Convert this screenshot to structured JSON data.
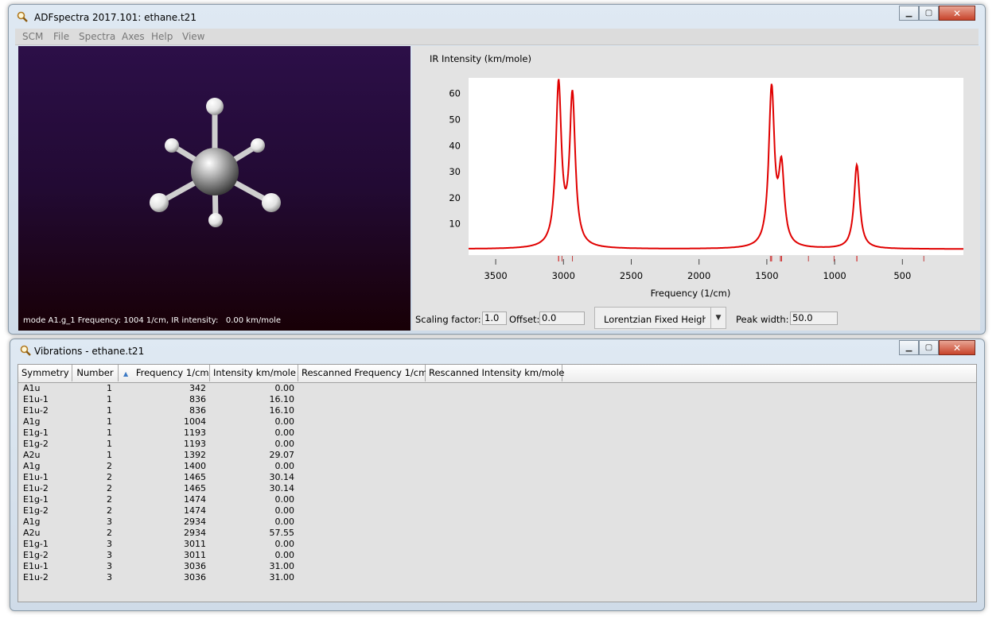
{
  "main_window": {
    "title": "ADFspectra 2017.101: ethane.t21",
    "menu": [
      "SCM",
      "File",
      "Spectra",
      "Axes",
      "Help",
      "View"
    ],
    "mode_text": "mode A1.g_1 Frequency: 1004 1/cm, IR intensity:   0.00 km/mole",
    "scaling_label": "Scaling factor:",
    "scaling_value": "1.0",
    "offset_label": "Offset:",
    "offset_value": "0.0",
    "lineshape_value": "Lorentzian Fixed Height",
    "peak_width_label": "Peak width:",
    "peak_width_value": "50.0"
  },
  "chart_data": {
    "type": "line",
    "title": "",
    "ylabel": "IR Intensity (km/mole)",
    "xlabel": "Frequency (1/cm)",
    "x_reversed": true,
    "xlim": [
      3700,
      50
    ],
    "ylim": [
      -2,
      66
    ],
    "xticks": [
      3500,
      3000,
      2500,
      2000,
      1500,
      1000,
      500
    ],
    "yticks": [
      10,
      20,
      30,
      40,
      50,
      60
    ],
    "line_color": "#e00000",
    "peak_width": 50,
    "lineshape": "lorentzian",
    "baseline": 0.3,
    "modes": [
      {
        "freq": 342,
        "intensity": 0.0
      },
      {
        "freq": 836,
        "intensity": 16.1
      },
      {
        "freq": 836,
        "intensity": 16.1
      },
      {
        "freq": 1004,
        "intensity": 0.0
      },
      {
        "freq": 1193,
        "intensity": 0.0
      },
      {
        "freq": 1193,
        "intensity": 0.0
      },
      {
        "freq": 1392,
        "intensity": 29.07
      },
      {
        "freq": 1400,
        "intensity": 0.0
      },
      {
        "freq": 1465,
        "intensity": 30.14
      },
      {
        "freq": 1465,
        "intensity": 30.14
      },
      {
        "freq": 1474,
        "intensity": 0.0
      },
      {
        "freq": 1474,
        "intensity": 0.0
      },
      {
        "freq": 2934,
        "intensity": 0.0
      },
      {
        "freq": 2934,
        "intensity": 57.55
      },
      {
        "freq": 3011,
        "intensity": 0.0
      },
      {
        "freq": 3011,
        "intensity": 0.0
      },
      {
        "freq": 3036,
        "intensity": 31.0
      },
      {
        "freq": 3036,
        "intensity": 31.0
      }
    ]
  },
  "vib_window": {
    "title": "Vibrations - ethane.t21",
    "columns": [
      "Symmetry",
      "Number",
      "Frequency 1/cm",
      "Intensity km/mole",
      "Rescanned Frequency 1/cm",
      "Rescanned Intensity km/mole"
    ],
    "sort_indicator": "▲",
    "rows": [
      [
        "A1u",
        "1",
        "342",
        "0.00"
      ],
      [
        "E1u-1",
        "1",
        "836",
        "16.10"
      ],
      [
        "E1u-2",
        "1",
        "836",
        "16.10"
      ],
      [
        "A1g",
        "1",
        "1004",
        "0.00"
      ],
      [
        "E1g-1",
        "1",
        "1193",
        "0.00"
      ],
      [
        "E1g-2",
        "1",
        "1193",
        "0.00"
      ],
      [
        "A2u",
        "1",
        "1392",
        "29.07"
      ],
      [
        "A1g",
        "2",
        "1400",
        "0.00"
      ],
      [
        "E1u-1",
        "2",
        "1465",
        "30.14"
      ],
      [
        "E1u-2",
        "2",
        "1465",
        "30.14"
      ],
      [
        "E1g-1",
        "2",
        "1474",
        "0.00"
      ],
      [
        "E1g-2",
        "2",
        "1474",
        "0.00"
      ],
      [
        "A1g",
        "3",
        "2934",
        "0.00"
      ],
      [
        "A2u",
        "2",
        "2934",
        "57.55"
      ],
      [
        "E1g-1",
        "3",
        "3011",
        "0.00"
      ],
      [
        "E1g-2",
        "3",
        "3011",
        "0.00"
      ],
      [
        "E1u-1",
        "3",
        "3036",
        "31.00"
      ],
      [
        "E1u-2",
        "3",
        "3036",
        "31.00"
      ]
    ]
  }
}
